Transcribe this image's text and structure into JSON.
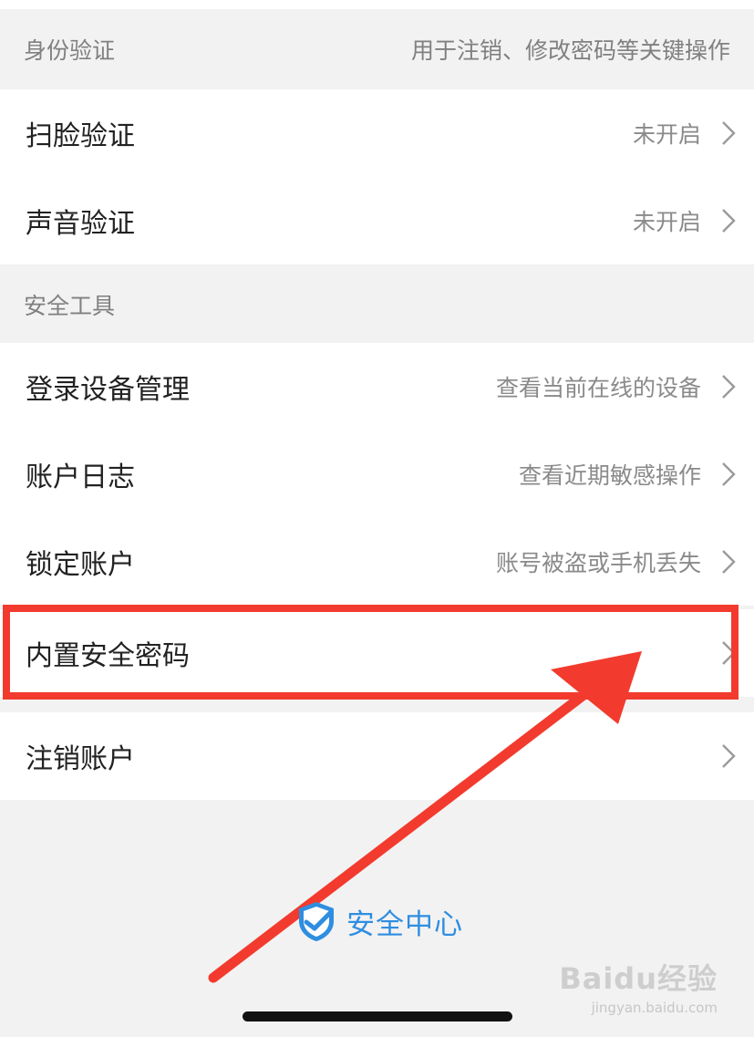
{
  "identity_section": {
    "title": "身份验证",
    "hint": "用于注销、修改密码等关键操作",
    "items": [
      {
        "label": "扫脸验证",
        "value": "未开启"
      },
      {
        "label": "声音验证",
        "value": "未开启"
      }
    ]
  },
  "tools_section": {
    "title": "安全工具",
    "items": [
      {
        "label": "登录设备管理",
        "value": "查看当前在线的设备"
      },
      {
        "label": "账户日志",
        "value": "查看近期敏感操作"
      },
      {
        "label": "锁定账户",
        "value": "账号被盗或手机丢失"
      },
      {
        "label": "内置安全密码",
        "value": ""
      },
      {
        "label": "注销账户",
        "value": ""
      }
    ]
  },
  "footer": {
    "brand": "安全中心",
    "icon": "shield-check-icon"
  },
  "watermark": {
    "main": "Baidu经验",
    "sub": "jingyan.baidu.com"
  },
  "colors": {
    "accent_blue": "#2f8ee0",
    "annotation_red": "#f23b2e",
    "background": "#f2f2f2"
  }
}
